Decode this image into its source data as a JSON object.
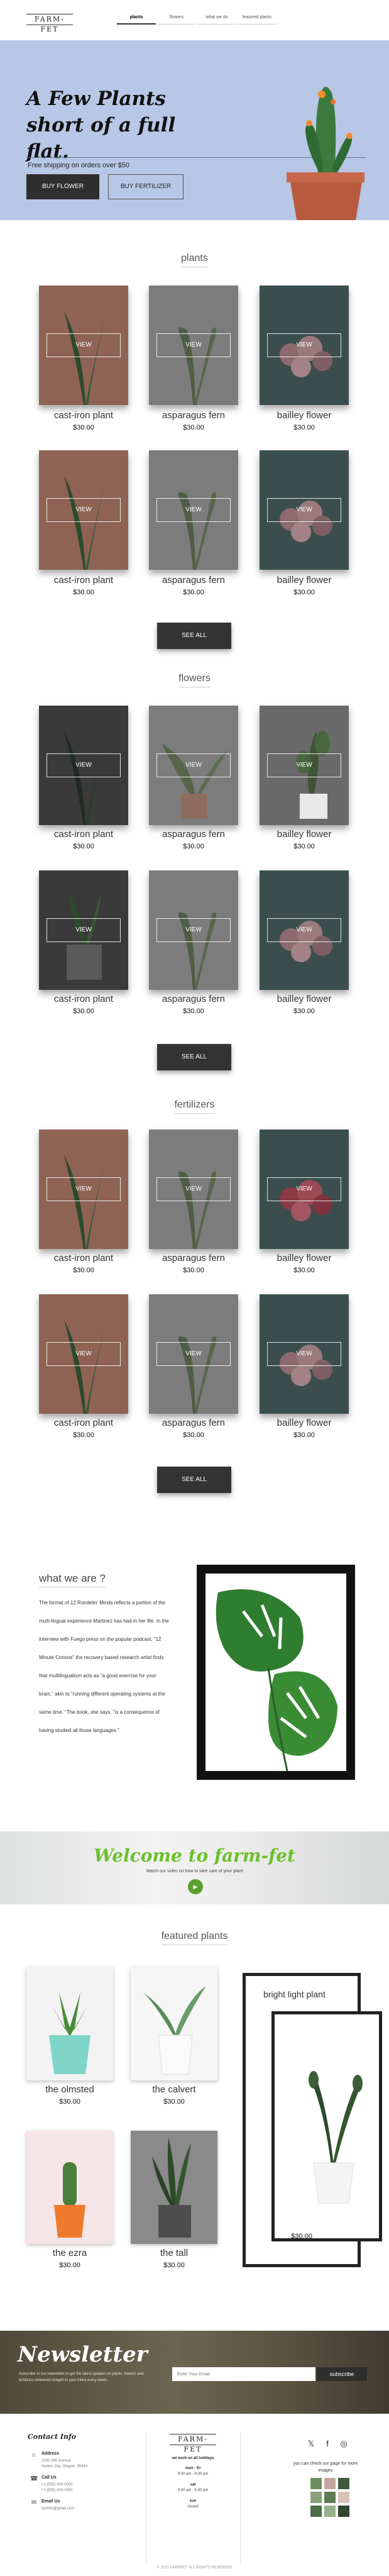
{
  "header": {
    "logo": "FARM-FET",
    "nav": [
      "plants",
      "flowers",
      "what we do",
      "featured plants"
    ]
  },
  "hero": {
    "title": "A Few Plants short of a full flat.",
    "subtitle": "Free shipping on orders over $50",
    "btn_flower": "BUY FLOWER",
    "btn_fertilizer": "BUY FERTILIZER"
  },
  "sections": {
    "plants": "plants",
    "flowers": "flowers",
    "fertilizers": "fertilizers",
    "see_all": "SEE ALL",
    "view": "VIEW"
  },
  "products": {
    "cast_iron": "cast-iron plant",
    "asparagus": "asparagus fern",
    "bailey": "bailley flower",
    "price": "$30.00"
  },
  "about": {
    "title": "what we are ?",
    "text": "The format of 12 Rondelin' Minds reflects a portion of the multi-lingual experience Martinez has had in her life. In the interview with Fuego press on the popular podcast, \"12 Minute Convos\" the recovery based research artist finds that multilingualism acts as \"a good exercise for your brain,\" akin to \"running different operating systems at the same time.\" The book, she says, \"is a consequence of having studied all those languages.\""
  },
  "welcome": {
    "title": "Welcome to farm-fet",
    "subtitle": "Watch our video on how to take care of your plant"
  },
  "featured": {
    "title": "featured plants",
    "items": [
      {
        "name": "the olmsted",
        "price": "$30.00"
      },
      {
        "name": "the calvert",
        "price": "$30.00"
      },
      {
        "name": "the ezra",
        "price": "$30.00"
      },
      {
        "name": "the tall",
        "price": "$30.00"
      }
    ],
    "bright": {
      "name": "bright light plant",
      "price": "$30.00"
    }
  },
  "newsletter": {
    "title": "Newsletter",
    "text": "Subscribe to our newsletter to get the latest updates on plants, flowers and fertilizers delivered straight to your inbox every week.",
    "placeholder": "Enter Your Email",
    "button": "subscribe"
  },
  "footer": {
    "contact_title": "Contact Info",
    "address_head": "Address",
    "address_1": "2200 NW Avenue",
    "address_2": "Harbor City, Oregon, 55454",
    "call_head": "Call Us",
    "call_1": "+1 (555) 000-0000",
    "call_2": "+1 (555) 000-0000",
    "email_head": "Email Us",
    "email": "farmfet@gmail.com",
    "logo": "FARM-FET",
    "hours_head": "we work on all holidays",
    "hours": [
      {
        "day": "mon - fri",
        "time": "9:00 am - 8:00 pm",
        "bold": true
      },
      {
        "day": "sat",
        "time": "9:00 am - 5:00 pm",
        "bold": true
      },
      {
        "day": "sun",
        "time": "closed",
        "bold": true
      }
    ],
    "insta_text": "you can check our page for more images",
    "copyright": "2021 FARMFET ALL RIGHTS RESERVED"
  },
  "colors": {
    "hero_bg": "#b8c7e6",
    "accent_green": "#6cbf2c",
    "button_dark": "#2e2e2e"
  }
}
